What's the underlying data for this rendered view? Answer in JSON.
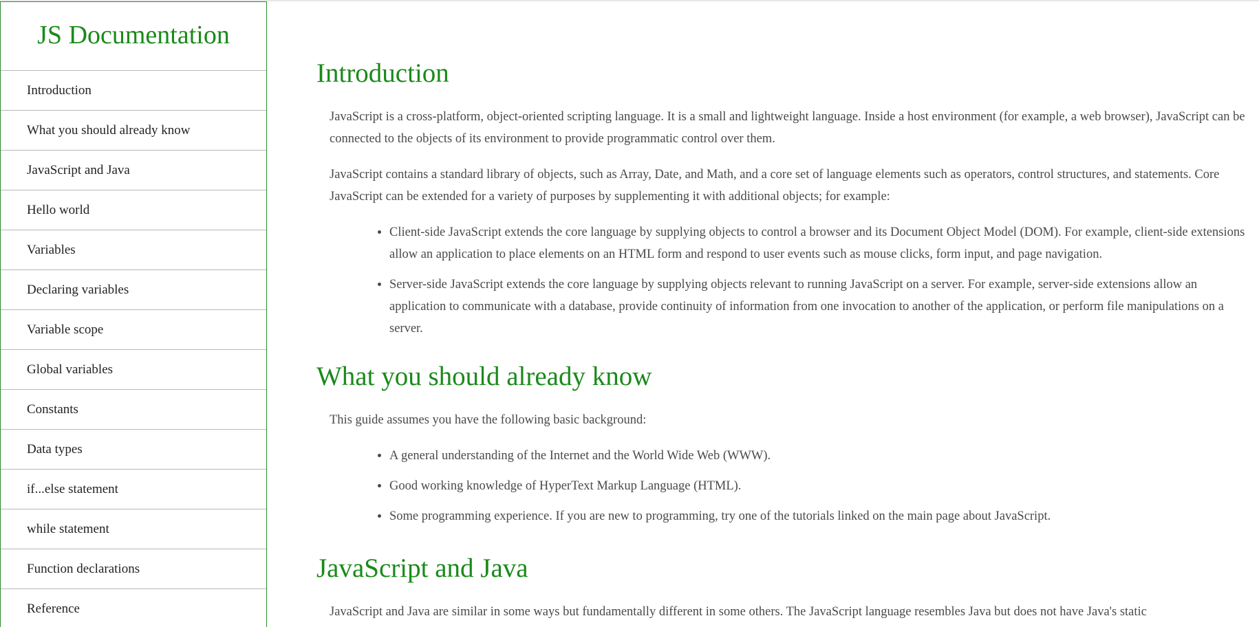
{
  "nav": {
    "title": "JS Documentation",
    "links": [
      "Introduction",
      "What you should already know",
      "JavaScript and Java",
      "Hello world",
      "Variables",
      "Declaring variables",
      "Variable scope",
      "Global variables",
      "Constants",
      "Data types",
      "if...else statement",
      "while statement",
      "Function declarations",
      "Reference"
    ]
  },
  "sections": {
    "introduction": {
      "heading": "Introduction",
      "p1": "JavaScript is a cross-platform, object-oriented scripting language. It is a small and lightweight language. Inside a host environment (for example, a web browser), JavaScript can be connected to the objects of its environment to provide programmatic control over them.",
      "p2": "JavaScript contains a standard library of objects, such as Array, Date, and Math, and a core set of language elements such as operators, control structures, and statements. Core JavaScript can be extended for a variety of purposes by supplementing it with additional objects; for example:",
      "bullets": [
        "Client-side JavaScript extends the core language by supplying objects to control a browser and its Document Object Model (DOM). For example, client-side extensions allow an application to place elements on an HTML form and respond to user events such as mouse clicks, form input, and page navigation.",
        "Server-side JavaScript extends the core language by supplying objects relevant to running JavaScript on a server. For example, server-side extensions allow an application to communicate with a database, provide continuity of information from one invocation to another of the application, or perform file manipulations on a server."
      ]
    },
    "already_know": {
      "heading": "What you should already know",
      "p1": "This guide assumes you have the following basic background:",
      "bullets": [
        "A general understanding of the Internet and the World Wide Web (WWW).",
        "Good working knowledge of HyperText Markup Language (HTML).",
        "Some programming experience. If you are new to programming, try one of the tutorials linked on the main page about JavaScript."
      ]
    },
    "js_and_java": {
      "heading": "JavaScript and Java",
      "p1": "JavaScript and Java are similar in some ways but fundamentally different in some others. The JavaScript language resembles Java but does not have Java's static"
    }
  },
  "colors": {
    "accent": "#1a8a1a",
    "text": "#4a4a4a",
    "divider": "#b8b8b8"
  }
}
